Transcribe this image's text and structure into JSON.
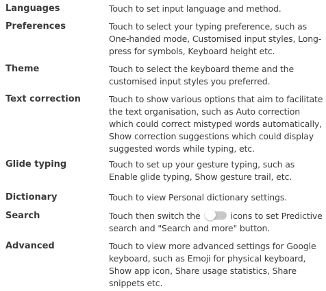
{
  "colors": {
    "text": "#3c3c3c",
    "term_text": "#3a3a3a",
    "toggle_track": "#c8c8c8",
    "toggle_knob": "#ffffff"
  },
  "entries": [
    {
      "term": "Languages",
      "lines": [
        "Touch to set input language and method."
      ]
    },
    {
      "term": "Preferences",
      "lines": [
        "Touch to select your typing preference, such as",
        "One-handed mode, Customised input styles, Long-",
        "press for symbols, Keyboard height etc."
      ]
    },
    {
      "term": "Theme",
      "lines": [
        "Touch to select the keyboard theme and the",
        "customised input styles you preferred."
      ]
    },
    {
      "term": "Text correction",
      "lines": [
        "Touch to show various options that aim to facilitate",
        "the text organisation, such as Auto correction",
        "which could correct mistyped words automatically,",
        "Show correction suggestions which could display",
        "suggested words while typing, etc."
      ]
    },
    {
      "term": "Glide typing",
      "lines": [
        "Touch to set up your gesture typing, such as",
        "Enable glide typing, Show gesture trail, etc."
      ]
    },
    {
      "term": "Dictionary",
      "lines": [
        "Touch to view Personal dictionary settings."
      ]
    },
    {
      "term": "Search",
      "line1_before_icon": "Touch then switch the",
      "line1_after_icon": "icons to set Predictive",
      "icon": "toggle-switch-off-icon",
      "lines": [
        "search and \"Search and more\" button."
      ]
    },
    {
      "term": "Advanced",
      "lines": [
        "Touch to view more advanced settings for Google",
        "keyboard, such as Emoji for physical keyboard,",
        "Show app icon, Share usage statistics, Share",
        "snippets etc."
      ]
    }
  ]
}
